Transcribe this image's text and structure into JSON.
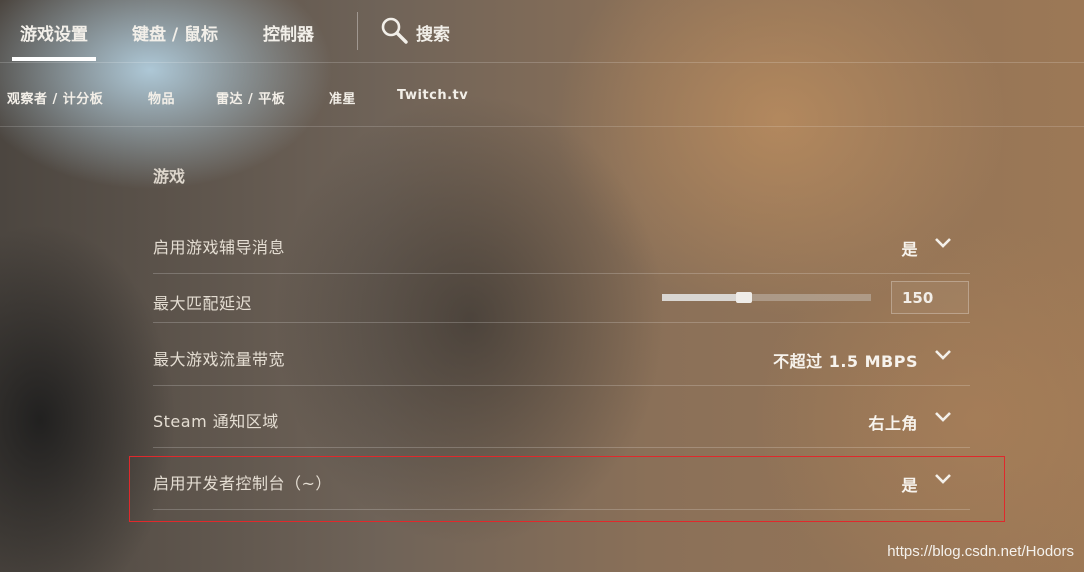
{
  "top_tabs": [
    {
      "label": "游戏设置",
      "active": true
    },
    {
      "label": "键盘 / 鼠标",
      "active": false
    },
    {
      "label": "控制器",
      "active": false
    }
  ],
  "search": {
    "label": "搜索",
    "icon": "search-icon"
  },
  "sub_tabs": [
    "观察者 / 计分板",
    "物品",
    "雷达 / 平板",
    "准星",
    "Twitch.tv"
  ],
  "section": {
    "title": "游戏"
  },
  "settings": [
    {
      "label": "启用游戏辅导消息",
      "value": "是",
      "control": "dropdown"
    },
    {
      "label": "最大匹配延迟",
      "value": "150",
      "control": "slider",
      "slider_level": 0.39
    },
    {
      "label": "最大游戏流量带宽",
      "value": "不超过 1.5 MBPS",
      "control": "dropdown"
    },
    {
      "label": "Steam 通知区域",
      "value": "右上角",
      "control": "dropdown"
    },
    {
      "label": "启用开发者控制台（~）",
      "value": "是",
      "control": "dropdown",
      "highlighted": true
    }
  ],
  "colors": {
    "highlight_border": "#e0292c",
    "active_underline": "#ffffff"
  },
  "watermark": "https://blog.csdn.net/Hodors"
}
